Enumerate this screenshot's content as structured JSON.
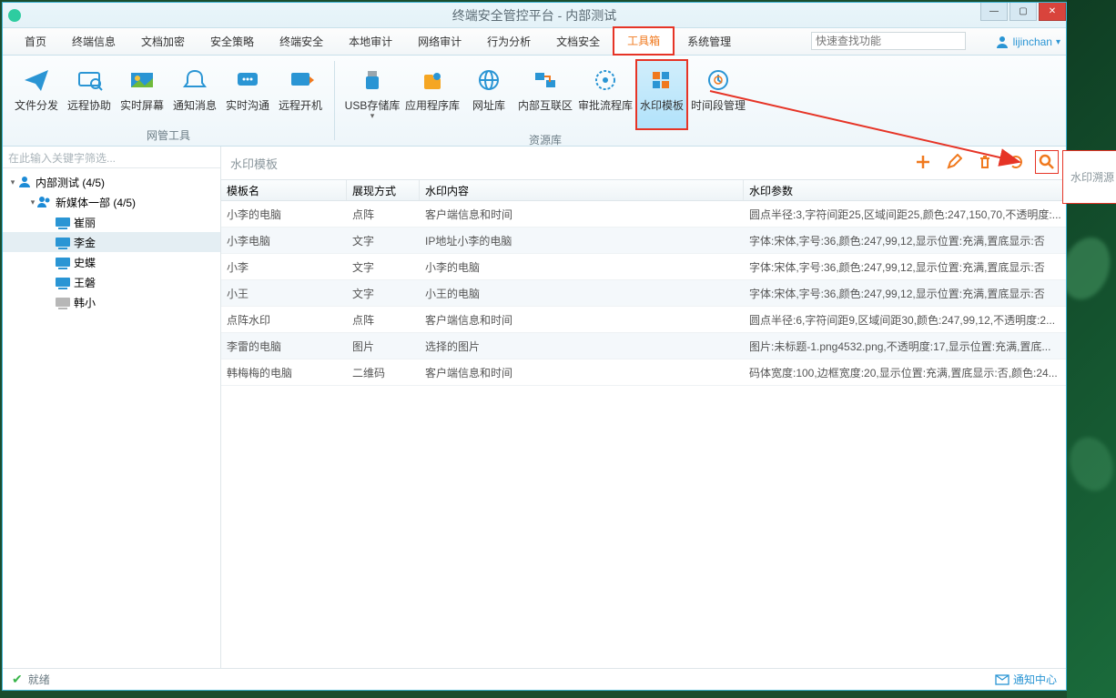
{
  "window": {
    "title": "终端安全管控平台 - 内部测试"
  },
  "menubar": {
    "items": [
      "首页",
      "终端信息",
      "文档加密",
      "安全策略",
      "终端安全",
      "本地审计",
      "网络审计",
      "行为分析",
      "文档安全",
      "工具箱",
      "系统管理"
    ],
    "active_index": 9,
    "search_placeholder": "快速查找功能",
    "user": "lijinchan"
  },
  "ribbon": {
    "group1_title": "网管工具",
    "group2_title": "资源库",
    "group1": [
      {
        "label": "文件分发"
      },
      {
        "label": "远程协助"
      },
      {
        "label": "实时屏幕"
      },
      {
        "label": "通知消息"
      },
      {
        "label": "实时沟通"
      },
      {
        "label": "远程开机"
      }
    ],
    "group2": [
      {
        "label": "USB存储库",
        "dropdown": true
      },
      {
        "label": "应用程序库"
      },
      {
        "label": "网址库"
      },
      {
        "label": "内部互联区"
      },
      {
        "label": "审批流程库"
      },
      {
        "label": "水印模板",
        "selected": true
      },
      {
        "label": "时间段管理"
      }
    ]
  },
  "sidebar": {
    "filter_placeholder": "在此输入关键字筛选...",
    "tree": {
      "root": {
        "label": "内部测试 (4/5)"
      },
      "group": {
        "label": "新媒体一部 (4/5)"
      },
      "members": [
        {
          "label": "崔丽",
          "online": true
        },
        {
          "label": "李金",
          "online": true,
          "selected": true
        },
        {
          "label": "史蝶",
          "online": true
        },
        {
          "label": "王磐",
          "online": true
        },
        {
          "label": "韩小",
          "online": false
        }
      ]
    }
  },
  "content": {
    "title": "水印模板",
    "tooltip": "水印溯源",
    "columns": [
      "模板名",
      "展现方式",
      "水印内容",
      "水印参数"
    ],
    "rows": [
      {
        "c1": "小李的电脑",
        "c2": "点阵",
        "c3": "客户端信息和时间",
        "c4": "圆点半径:3,字符间距25,区域间距25,颜色:247,150,70,不透明度:..."
      },
      {
        "c1": "小李电脑",
        "c2": "文字",
        "c3": "IP地址小李的电脑",
        "c4": "字体:宋体,字号:36,颜色:247,99,12,显示位置:充满,置底显示:否"
      },
      {
        "c1": "小李",
        "c2": "文字",
        "c3": "小李的电脑",
        "c4": "字体:宋体,字号:36,颜色:247,99,12,显示位置:充满,置底显示:否"
      },
      {
        "c1": "小王",
        "c2": "文字",
        "c3": "小王的电脑",
        "c4": "字体:宋体,字号:36,颜色:247,99,12,显示位置:充满,置底显示:否"
      },
      {
        "c1": "点阵水印",
        "c2": "点阵",
        "c3": "客户端信息和时间",
        "c4": "圆点半径:6,字符间距9,区域间距30,颜色:247,99,12,不透明度:2..."
      },
      {
        "c1": "李雷的电脑",
        "c2": "图片",
        "c3": "选择的图片",
        "c4": "图片:未标题-1.png4532.png,不透明度:17,显示位置:充满,置底..."
      },
      {
        "c1": "韩梅梅的电脑",
        "c2": "二维码",
        "c3": "客户端信息和时间",
        "c4": "码体宽度:100,边框宽度:20,显示位置:充满,置底显示:否,颜色:24..."
      }
    ]
  },
  "statusbar": {
    "text": "就绪",
    "notify": "通知中心"
  }
}
